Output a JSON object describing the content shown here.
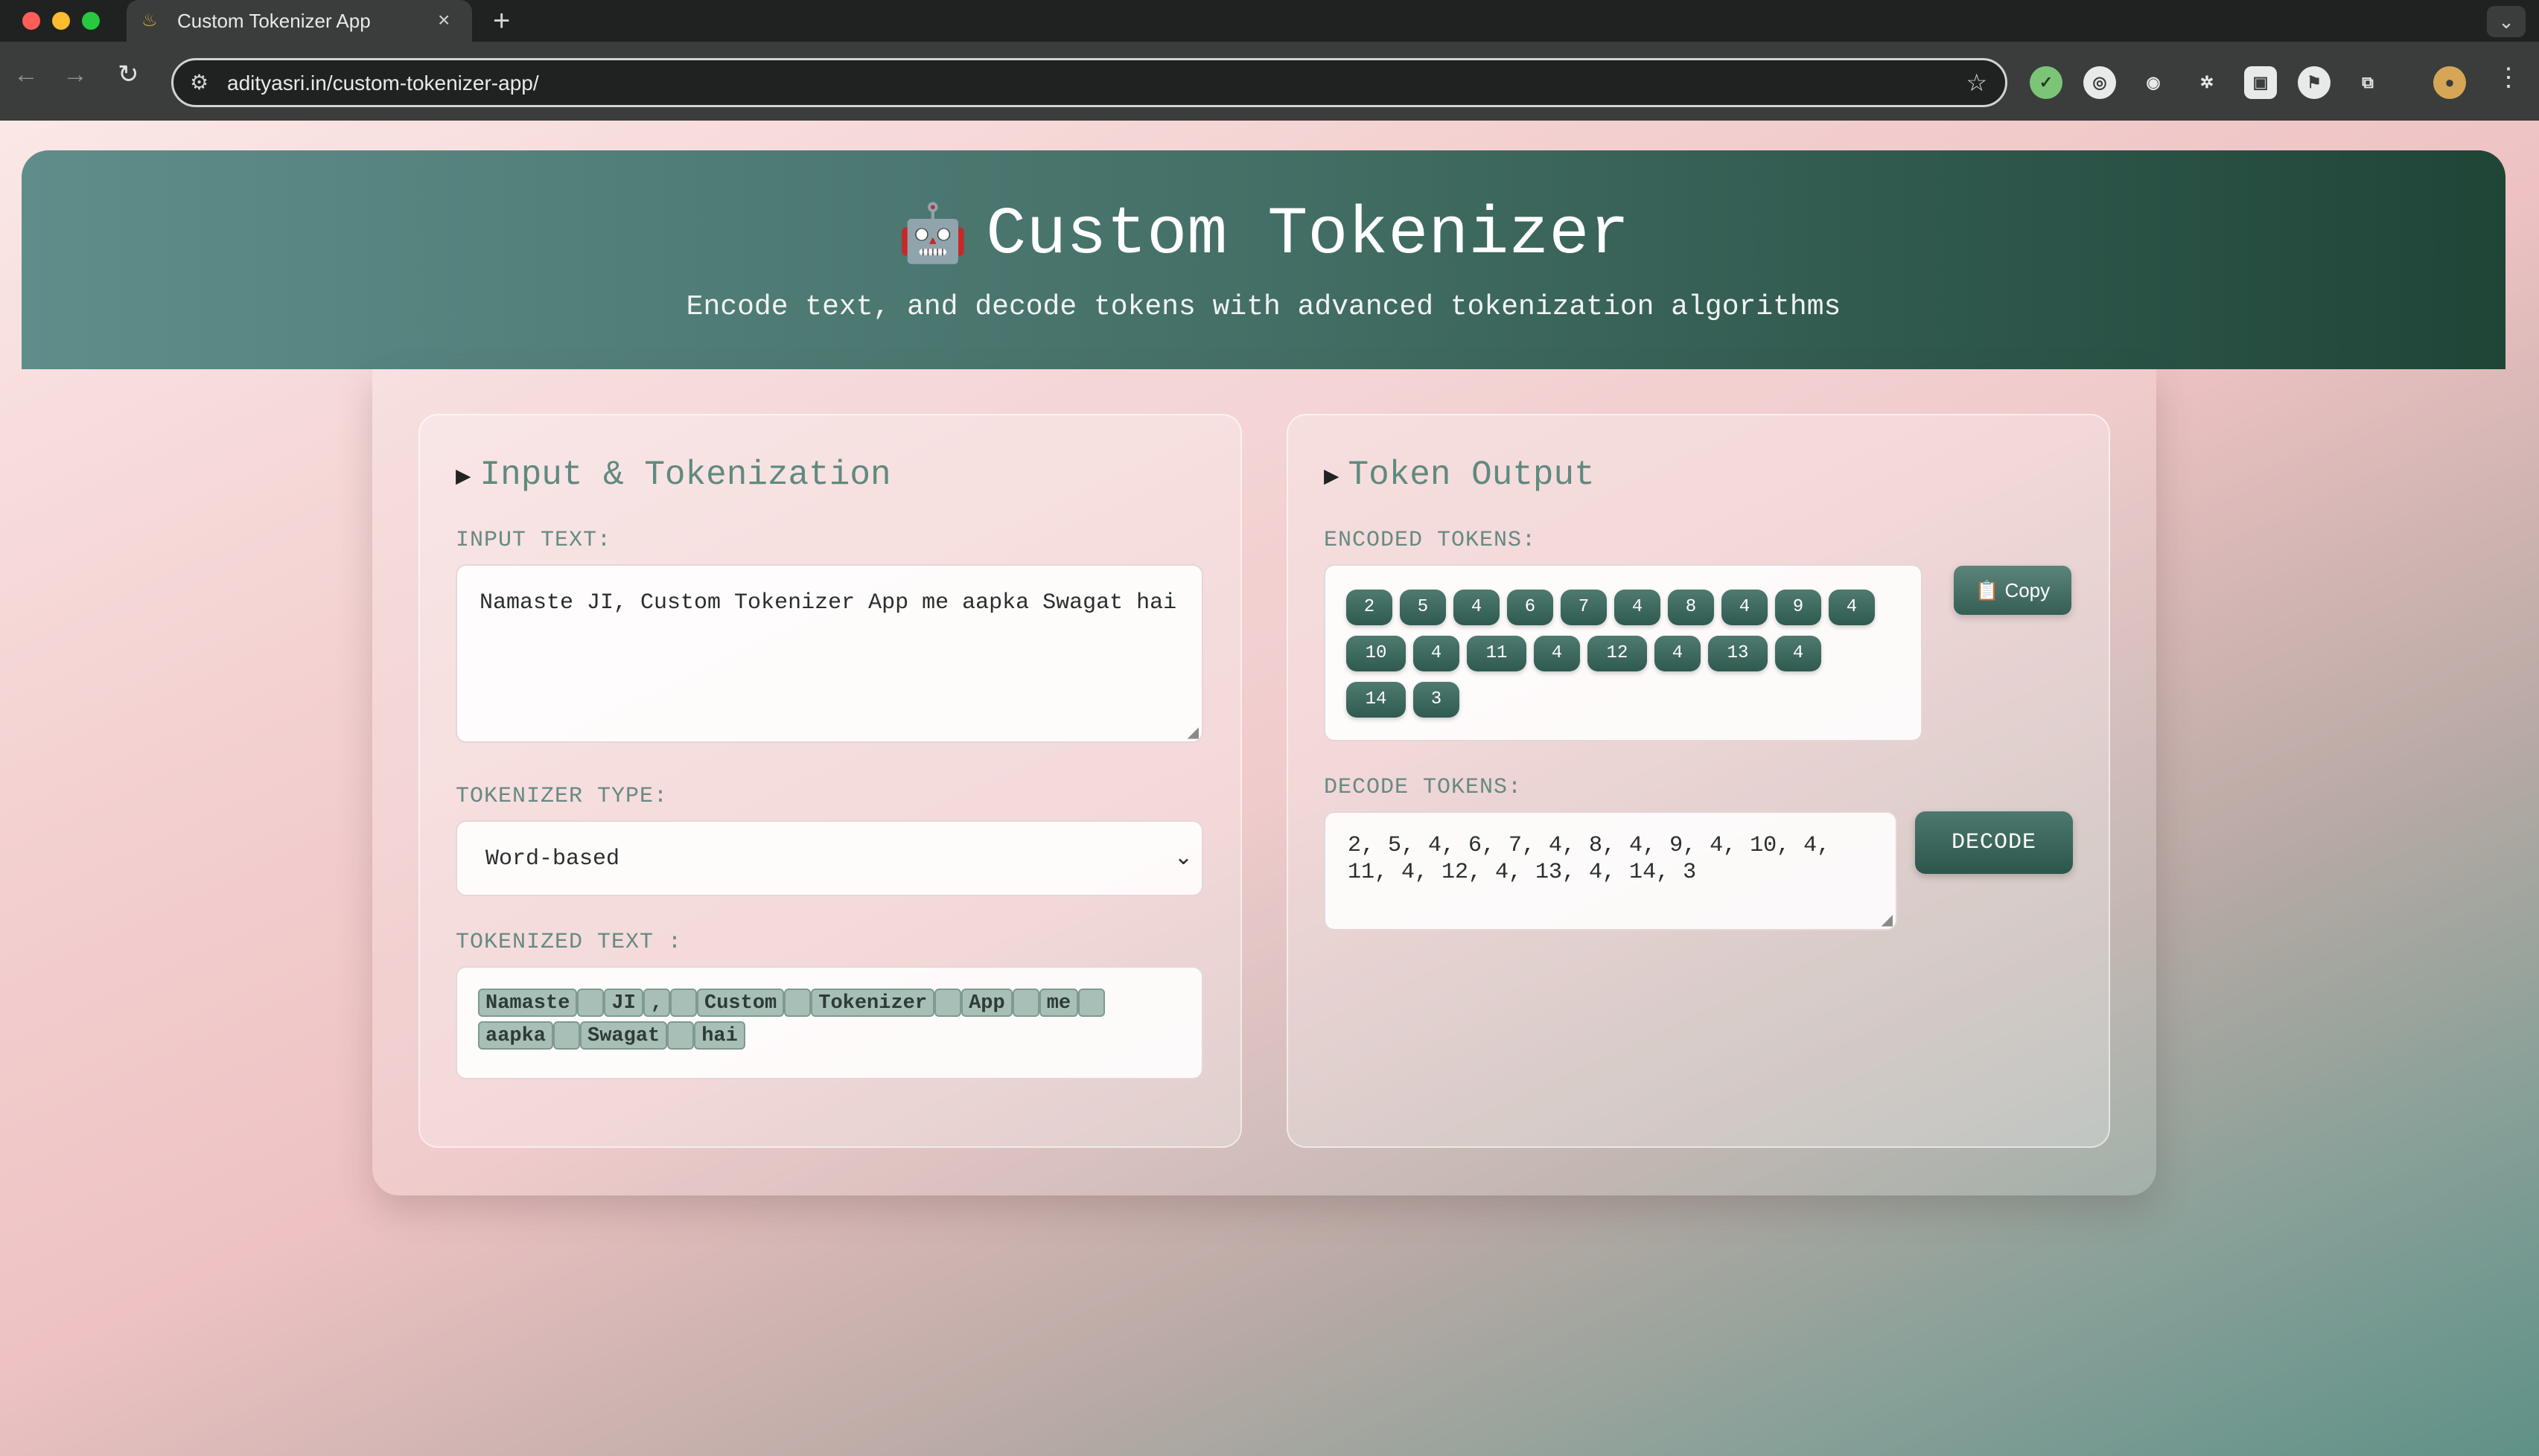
{
  "browser": {
    "tab_title": "Custom Tokenizer App",
    "tab_close": "×",
    "new_tab": "+",
    "url": "adityasri.in/custom-tokenizer-app/"
  },
  "header": {
    "emoji": "🤖",
    "title": "Custom Tokenizer",
    "subtitle": "Encode text, and decode tokens with advanced tokenization algorithms"
  },
  "input_panel": {
    "title": "Input & Tokenization",
    "input_label": "INPUT TEXT:",
    "input_value": "Namaste JI, Custom Tokenizer App me aapka Swagat hai",
    "type_label": "TOKENIZER TYPE:",
    "type_value": "Word-based",
    "tokenized_label": "TOKENIZED TEXT :",
    "tokens": [
      "Namaste",
      " ",
      "JI",
      ",",
      " ",
      "Custom",
      " ",
      "Tokenizer",
      " ",
      "App",
      " ",
      "me",
      " ",
      "aapka",
      " ",
      "Swagat",
      " ",
      "hai"
    ]
  },
  "output_panel": {
    "title": "Token Output",
    "encoded_label": "ENCODED TOKENS:",
    "encoded_tokens": [
      "2",
      "5",
      "4",
      "6",
      "7",
      "4",
      "8",
      "4",
      "9",
      "4",
      "10",
      "4",
      "11",
      "4",
      "12",
      "4",
      "13",
      "4",
      "14",
      "3"
    ],
    "copy_label": "📋 Copy",
    "decode_label": "DECODE TOKENS:",
    "decode_value": "2, 5, 4, 6, 7, 4, 8, 4, 9, 4, 10, 4, 11, 4, 12, 4, 13, 4, 14, 3",
    "decode_button": "DECODE"
  }
}
